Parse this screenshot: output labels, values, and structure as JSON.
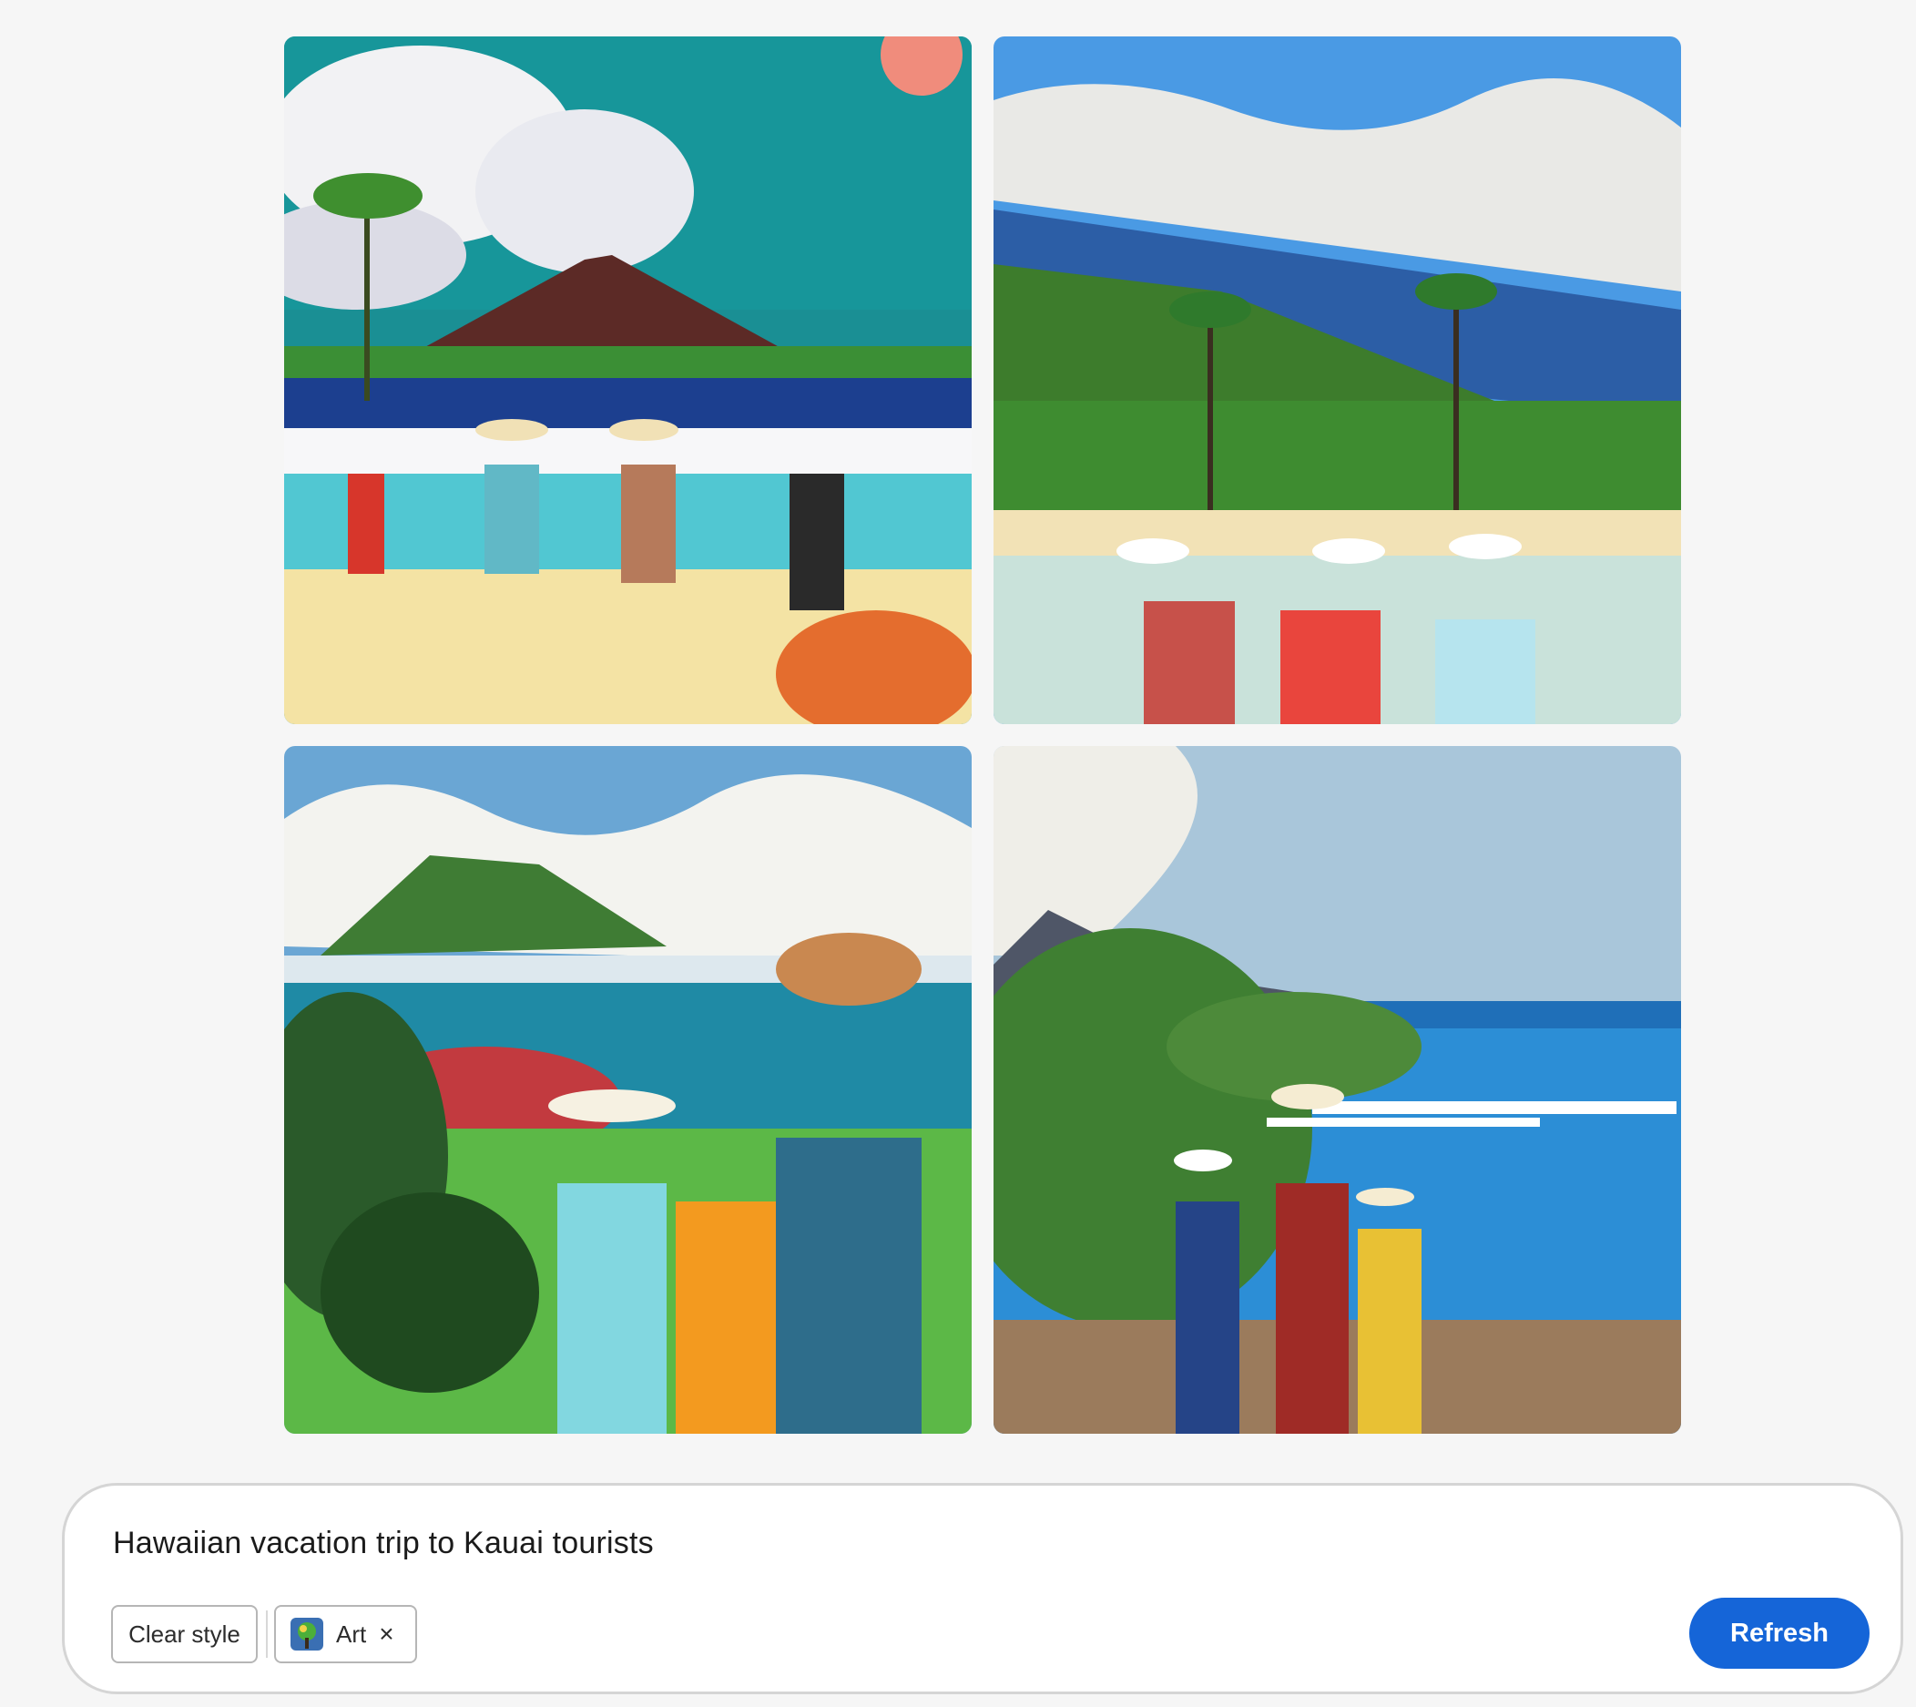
{
  "gallery": {
    "images": [
      {
        "description_icon": "image-1"
      },
      {
        "description_icon": "image-2"
      },
      {
        "description_icon": "image-3"
      },
      {
        "description_icon": "image-4"
      }
    ]
  },
  "prompt": {
    "text": "Hawaiian vacation trip to Kauai tourists"
  },
  "style_controls": {
    "clear_label": "Clear style",
    "active_style_label": "Art",
    "remove_icon": "close-icon",
    "remove_glyph": "×"
  },
  "actions": {
    "refresh_label": "Refresh"
  },
  "colors": {
    "background": "#f6f6f6",
    "accent": "#1565d8",
    "panel_border": "#d5d5d5"
  }
}
